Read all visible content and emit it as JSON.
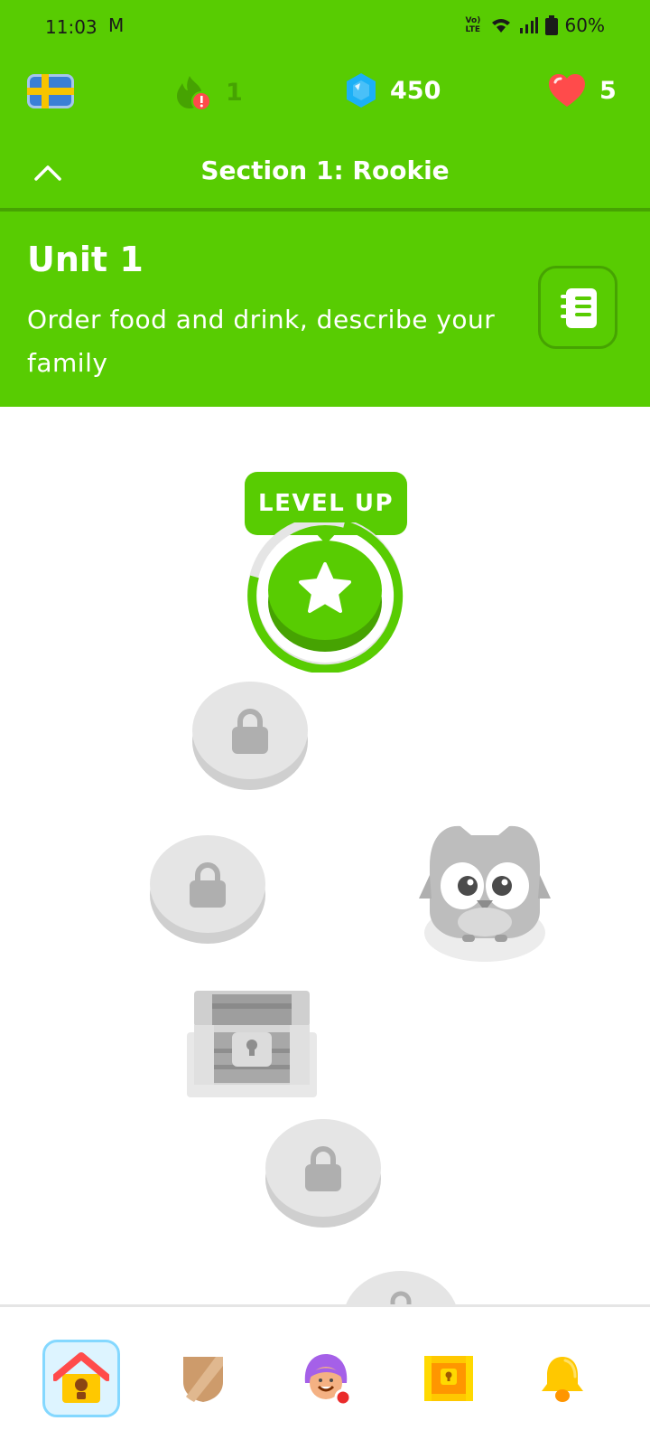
{
  "status_bar": {
    "time": "11:03",
    "gmail_glyph": "M",
    "network_label": "Vo) LTE",
    "battery": "60%"
  },
  "header": {
    "course_flag": "sweden-flag",
    "streak_count": "1",
    "gems_count": "450",
    "hearts_count": "5",
    "section_title": "Section 1: Rookie"
  },
  "unit": {
    "title": "Unit 1",
    "description": "Order food and drink, describe your family"
  },
  "path": {
    "level_up_label": "LEVEL UP",
    "nodes": [
      "current-star",
      "locked",
      "locked",
      "chest-locked",
      "locked",
      "locked"
    ]
  },
  "nav": {
    "items": [
      "home",
      "leagues",
      "practice-character",
      "quests",
      "notifications"
    ],
    "active": "home"
  },
  "colors": {
    "brand_green": "#58cc02",
    "brand_green_dark": "#46a302",
    "locked_gray": "#e5e5e5",
    "gem_blue": "#1cb0f6",
    "heart_red": "#ff4b4b"
  }
}
